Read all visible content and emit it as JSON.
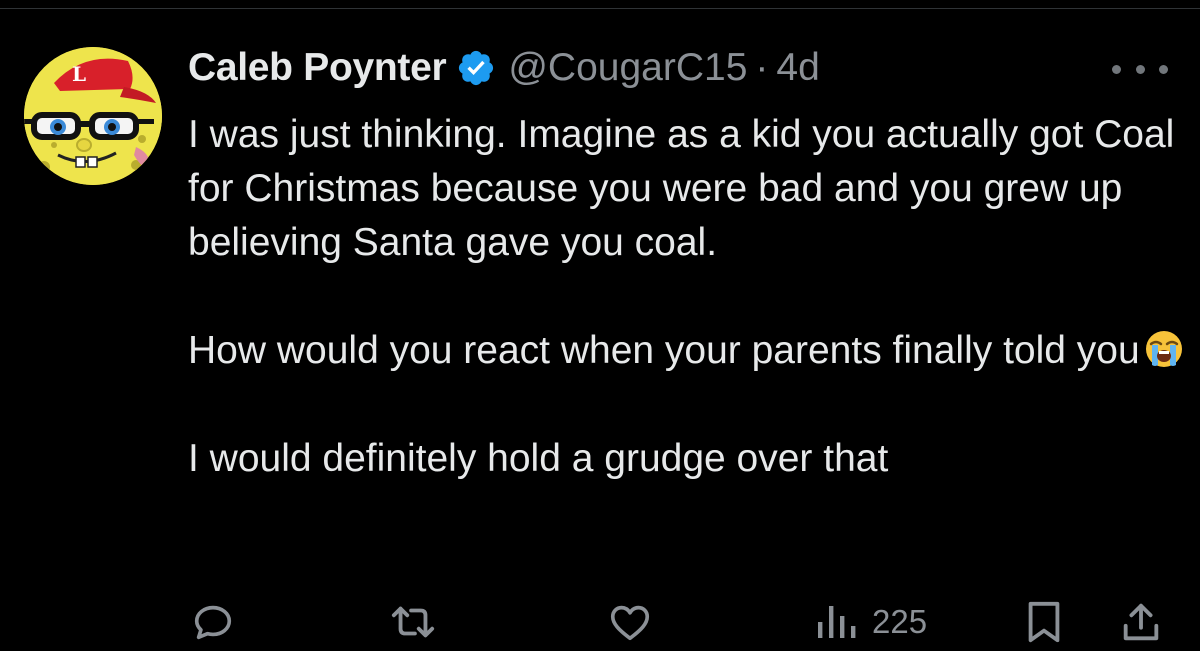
{
  "tweet": {
    "author": {
      "display_name": "Caleb Poynter",
      "handle": "@CougarC15",
      "verified": true,
      "avatar_icon": "spongebob-avatar-icon",
      "avatar_hat_letter": "L"
    },
    "separator": "·",
    "time": "4d",
    "body": {
      "paragraph_1": "I was just thinking. Imagine as a kid you actually got Coal for Christmas because you were bad and you grew up believing Santa gave you coal.",
      "paragraph_2": "How would you react when your parents finally told you",
      "paragraph_2_emoji": "loudly-crying-face-emoji",
      "paragraph_3": "I would definitely hold a grudge over that"
    },
    "stats": {
      "views": "225"
    },
    "icons": {
      "reply": "reply-icon",
      "retweet": "retweet-icon",
      "like": "like-icon",
      "views": "views-icon",
      "bookmark": "bookmark-icon",
      "share": "share-icon",
      "more": "more-icon",
      "verified": "verified-badge-icon"
    },
    "colors": {
      "background": "#000000",
      "text": "#e7e9ea",
      "secondary": "#8b9096",
      "verified": "#1d9bf0"
    }
  }
}
